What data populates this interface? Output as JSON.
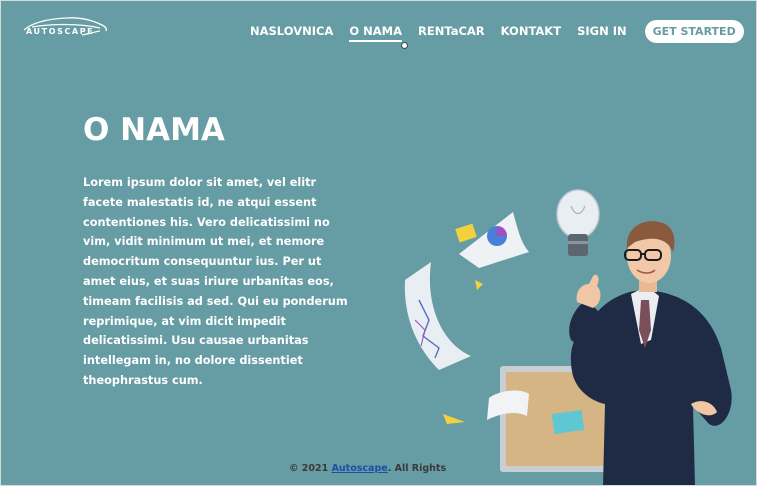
{
  "brand": {
    "logo_text": "AUTOSCAPE"
  },
  "nav": {
    "items": [
      {
        "label": "NASLOVNICA",
        "active": false
      },
      {
        "label": "O NAMA",
        "active": true
      },
      {
        "label": "RENTaCAR",
        "active": false
      },
      {
        "label": "KONTAKT",
        "active": false
      },
      {
        "label": "SIGN IN",
        "active": false
      }
    ],
    "cta_label": "GET STARTED"
  },
  "main": {
    "title": "O NAMA",
    "paragraph": "Lorem ipsum dolor sit amet, vel elitr facete malestatis id, ne atqui essent contentiones his. Vero delicatissimi no vim, vidit minimum ut mei, et nemore democritum consequuntur ius. Per ut amet eius, et suas iriure urbanitas eos, timeam facilisis ad sed. Qui eu ponderum reprimique, at vim dicit impedit delicatissimi. Usu causae urbanitas intellegam in, no dolore dissentiet theophrastus cum."
  },
  "footer": {
    "prefix": "© 2021 ",
    "brand_link": "Autoscape",
    "suffix": ". All Rights"
  },
  "colors": {
    "background": "#669ca3",
    "text": "#ffffff",
    "footer_text": "#3a3a3a",
    "link": "#1d4fa6",
    "suit": "#1f2b45"
  }
}
